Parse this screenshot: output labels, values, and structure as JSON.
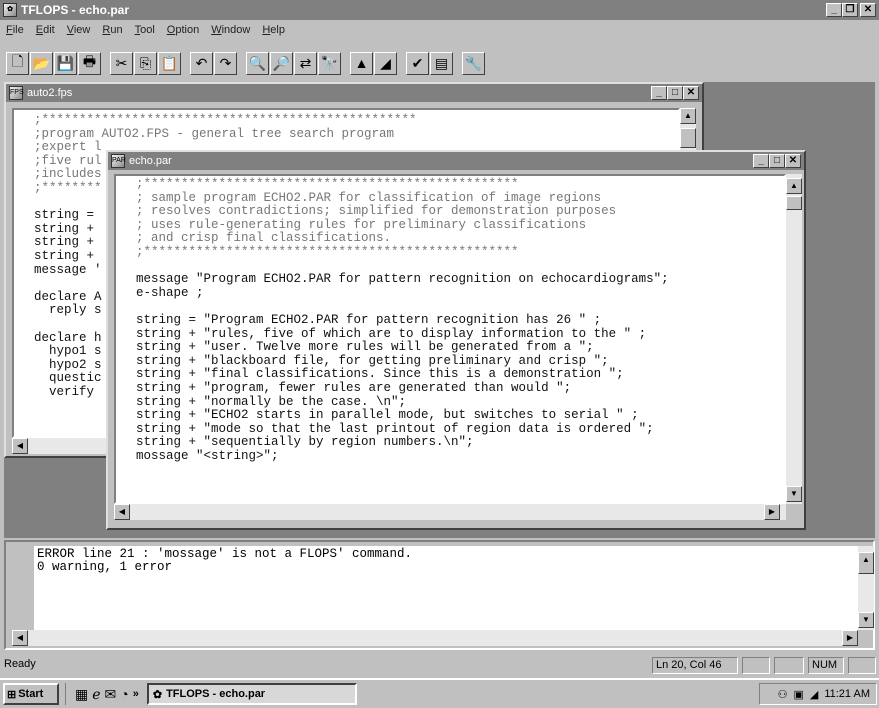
{
  "app": {
    "title": "TFLOPS - echo.par"
  },
  "menu": [
    "File",
    "Edit",
    "View",
    "Run",
    "Tool",
    "Option",
    "Window",
    "Help"
  ],
  "toolbar": [
    {
      "icon": "new-file-icon",
      "glyph": "🗋"
    },
    {
      "icon": "open-folder-icon",
      "glyph": "📂"
    },
    {
      "icon": "save-icon",
      "glyph": "💾"
    },
    {
      "icon": "print-icon",
      "glyph": "🖶"
    },
    {
      "icon": "cut-icon",
      "glyph": "✂"
    },
    {
      "icon": "copy-icon",
      "glyph": "⎘"
    },
    {
      "icon": "paste-icon",
      "glyph": "📋"
    },
    {
      "icon": "undo-icon",
      "glyph": "↶"
    },
    {
      "icon": "redo-icon",
      "glyph": "↷"
    },
    {
      "icon": "find-icon",
      "glyph": "🔍"
    },
    {
      "icon": "find-next-icon",
      "glyph": "🔎"
    },
    {
      "icon": "replace-icon",
      "glyph": "⇄"
    },
    {
      "icon": "find-in-files-icon",
      "glyph": "🔭"
    },
    {
      "icon": "compile-icon",
      "glyph": "▲"
    },
    {
      "icon": "run-icon",
      "glyph": "◢"
    },
    {
      "icon": "check-icon",
      "glyph": "✔"
    },
    {
      "icon": "rule-icon",
      "glyph": "▤"
    },
    {
      "icon": "tools-icon",
      "glyph": "🔧"
    }
  ],
  "auto2": {
    "title": "auto2.fps",
    "lines": [
      ";**************************************************",
      ";program AUTO2.FPS - general tree search program",
      ";expert l",
      ";five rul",
      ";includes",
      ";********",
      "",
      "string =",
      "string +",
      "string +",
      "string +",
      "message '",
      "",
      "declare A",
      "  reply s",
      "",
      "declare h",
      "  hypo1 s",
      "  hypo2 s",
      "  questic",
      "  verify"
    ]
  },
  "echo": {
    "title": "echo.par",
    "lines": [
      ";**************************************************",
      "; sample program ECHO2.PAR for classification of image regions",
      "; resolves contradictions; simplified for demonstration purposes",
      "; uses rule-generating rules for preliminary classifications",
      "; and crisp final classifications.",
      ";**************************************************",
      "",
      "message \"Program ECHO2.PAR for pattern recognition on echocardiograms\";",
      "e-shape ;",
      "",
      "string = \"Program ECHO2.PAR for pattern recognition has 26 \" ;",
      "string + \"rules, five of which are to display information to the \" ;",
      "string + \"user. Twelve more rules will be generated from a \";",
      "string + \"blackboard file, for getting preliminary and crisp \";",
      "string + \"final classifications. Since this is a demonstration \";",
      "string + \"program, fewer rules are generated than would \";",
      "string + \"normally be the case. \\n\";",
      "string + \"ECHO2 starts in parallel mode, but switches to serial \" ;",
      "string + \"mode so that the last printout of region data is ordered \";",
      "string + \"sequentially by region numbers.\\n\";",
      "mossage \"<string>\";"
    ]
  },
  "output": {
    "lines": [
      "ERROR line 21 : 'mossage' is not a FLOPS' command.",
      "0 warning, 1 error"
    ]
  },
  "status": {
    "text": "Ready",
    "position": "Ln 20, Col 46",
    "numlock": "NUM"
  },
  "taskbar": {
    "start": "Start",
    "task": "TFLOPS - echo.par",
    "clock": "11:21 AM"
  }
}
